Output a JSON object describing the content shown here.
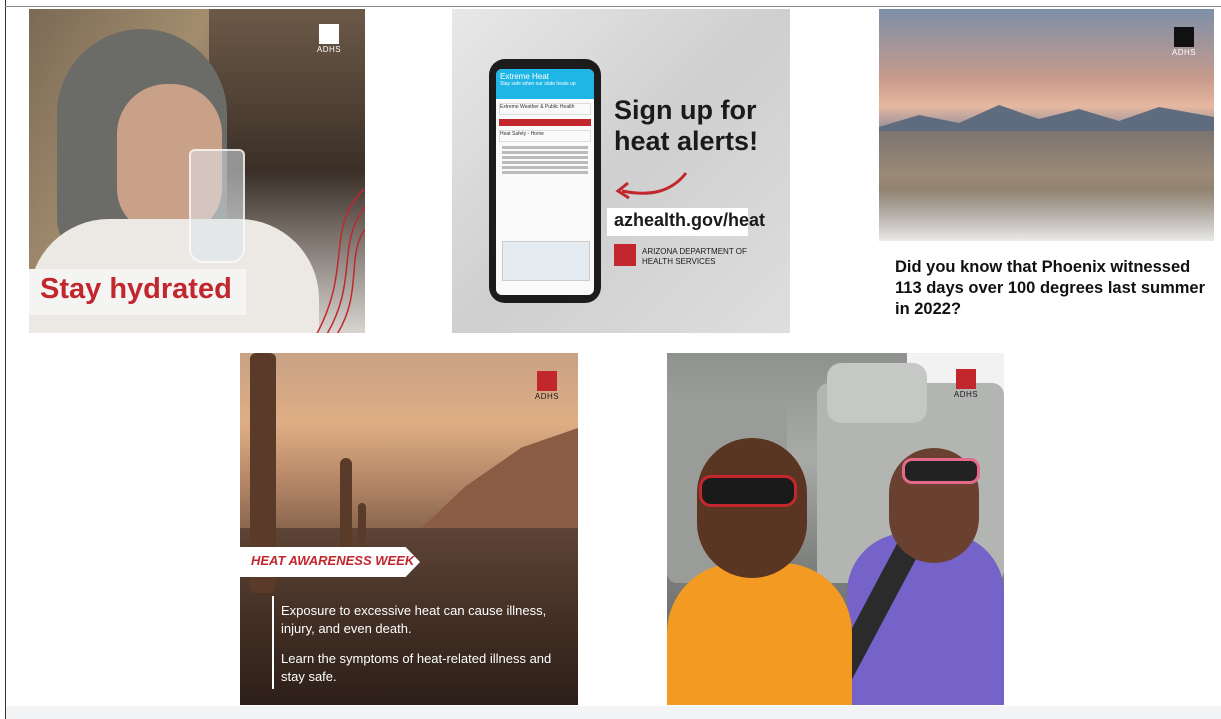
{
  "tiles": {
    "hydrated": {
      "title": "Stay hydrated",
      "logo_text": "ADHS"
    },
    "alerts": {
      "app_header": "Extreme Heat",
      "app_subheader": "Stay safe when our state heats up",
      "app_menu_item": "Extreme Weather & Public Health",
      "app_breadcrumb": "Heat Safety - Home",
      "headline": "Sign up for heat alerts!",
      "url": "azhealth.gov/heat",
      "department": "ARIZONA DEPARTMENT OF HEALTH SERVICES"
    },
    "phoenix": {
      "caption": "Did you know that Phoenix witnessed 113 days over 100 degrees last summer in 2022?",
      "logo_text": "ADHS"
    },
    "awareness": {
      "banner": "HEAT AWARENESS WEEK",
      "paragraph_1": "Exposure to excessive heat can cause illness, injury, and even death.",
      "paragraph_2": "Learn the symptoms of heat-related illness and stay safe.",
      "logo_text": "ADHS"
    },
    "kids": {
      "logo_text": "ADHS"
    }
  },
  "colors": {
    "brand_red": "#c1272d",
    "ink": "#111111"
  },
  "icons": {
    "logo": "adhs-logo-icon",
    "arrow": "curved-arrow-icon"
  }
}
